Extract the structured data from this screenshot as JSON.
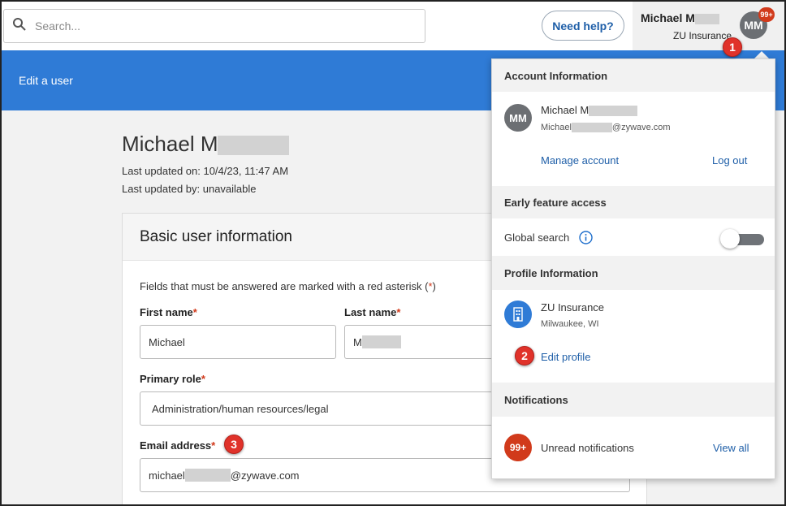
{
  "search": {
    "placeholder": "Search..."
  },
  "header": {
    "help_label": "Need help?",
    "user_name": "Michael M",
    "user_org": "ZU Insurance",
    "avatar_initials": "MM",
    "notif_badge": "99+"
  },
  "banner": {
    "title": "Edit a user"
  },
  "user": {
    "name": "Michael M",
    "last_updated_on": "Last updated on: 10/4/23, 11:47 AM",
    "last_updated_by": "Last updated by: unavailable"
  },
  "form": {
    "section_title": "Basic user information",
    "required_note": "Fields that must be answered are marked with a red asterisk (",
    "required_note_star": "*",
    "required_note_end": ")",
    "asterisk": "*",
    "first_name_label": "First name",
    "first_name_value": "Michael",
    "last_name_label": "Last name",
    "last_name_value": "M",
    "primary_role_label": "Primary role",
    "primary_role_value": "Administration/human resources/legal",
    "email_label": "Email address",
    "email_prefix": "michael",
    "email_suffix": "@zywave.com"
  },
  "dropdown": {
    "account_heading": "Account Information",
    "account_name": "Michael M",
    "account_email_prefix": "Michael",
    "account_email_suffix": "@zywave.com",
    "avatar_initials": "MM",
    "manage_account": "Manage account",
    "log_out": "Log out",
    "early_heading": "Early feature access",
    "global_search": "Global search",
    "profile_heading": "Profile Information",
    "profile_org": "ZU Insurance",
    "profile_location": "Milwaukee, WI",
    "edit_profile": "Edit profile",
    "notifications_heading": "Notifications",
    "notif_count": "99+",
    "unread_label": "Unread notifications",
    "view_all": "View all"
  },
  "steps": {
    "one": "1",
    "two": "2",
    "three": "3"
  },
  "colors": {
    "accent_blue": "#2f7bd6",
    "link_blue": "#1f5fa8",
    "required_red": "#d13a1b",
    "step_red": "#e0322a"
  },
  "toggles": {
    "global_search_on": false
  }
}
